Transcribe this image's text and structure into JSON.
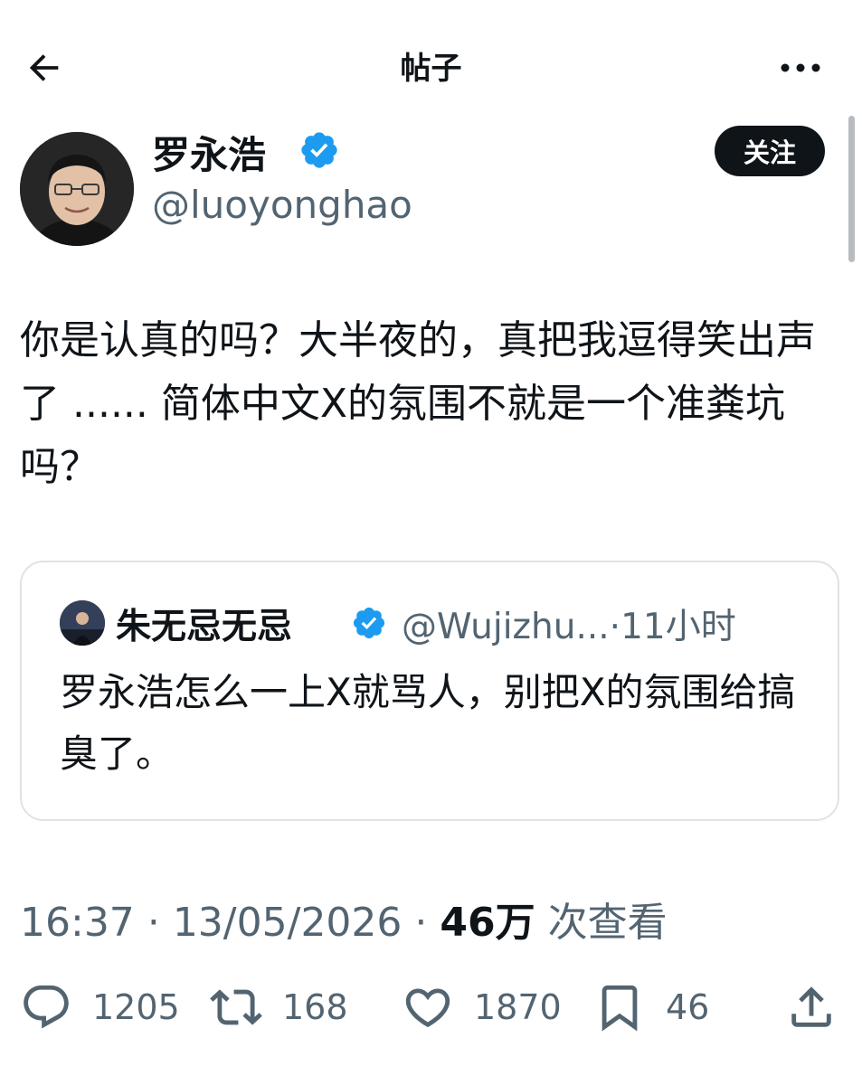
{
  "header": {
    "title": "帖子"
  },
  "author": {
    "name": "罗永浩",
    "handle": "@luoyonghao"
  },
  "follow_label": "关注",
  "tweet": {
    "text": "你是认真的吗？大半夜的，真把我逗得笑出声了 ...... 简体中文X的氛围不就是一个准粪坑吗？"
  },
  "quote": {
    "name": "朱无忌无忌",
    "handle": "@Wujizhu...",
    "separator": "·",
    "time": "11小时",
    "text": "罗永浩怎么一上X就骂人，别把X的氛围给搞臭了。"
  },
  "meta": {
    "time": "16:37",
    "dot1": "·",
    "date": "13/05/2026",
    "dot2": "·",
    "views_count": "46万",
    "views_label": "次查看"
  },
  "actions": {
    "replies": "1205",
    "reposts": "168",
    "likes": "1870",
    "bookmarks": "46"
  },
  "icons": [
    "back-arrow-icon",
    "more-icon",
    "verified-icon",
    "reply-icon",
    "repost-icon",
    "like-icon",
    "bookmark-icon",
    "share-icon"
  ],
  "colors": {
    "verified": "#1d9bf0",
    "text": "#0f1419",
    "secondary": "#536471",
    "follow_bg": "#0f1419"
  }
}
